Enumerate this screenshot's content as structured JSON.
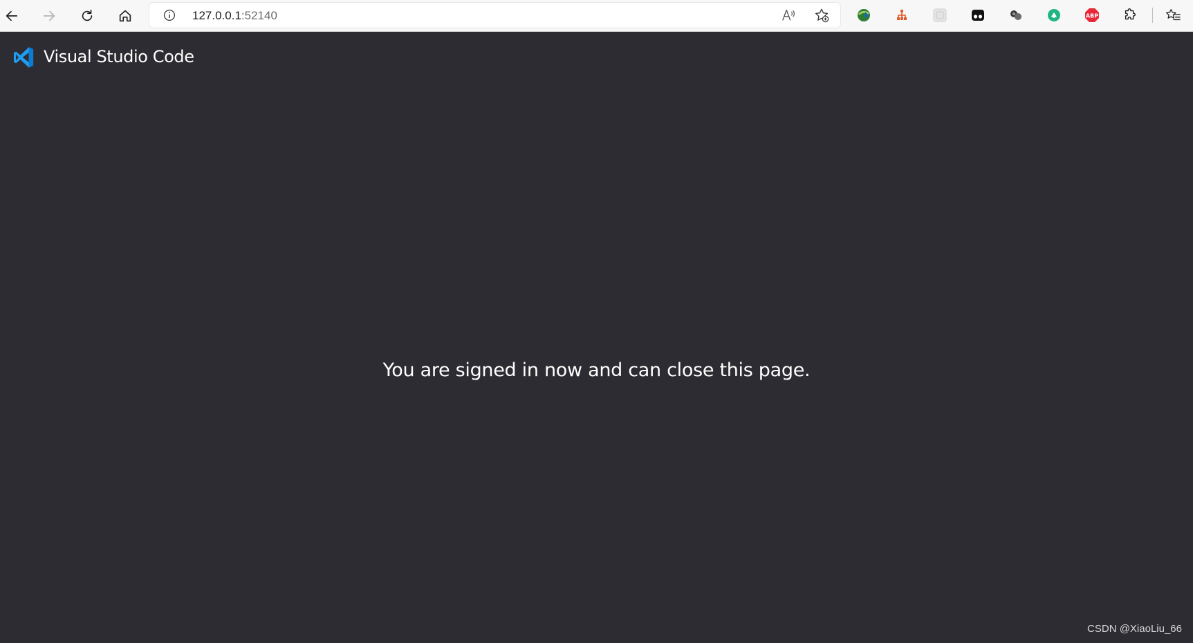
{
  "browser": {
    "address": {
      "host": "127.0.0.1",
      "port": ":52140"
    },
    "icons": {
      "back": "back-arrow-icon",
      "forward": "forward-arrow-icon",
      "refresh": "refresh-icon",
      "home": "home-icon",
      "info": "info-icon",
      "read_aloud": "read-aloud-icon",
      "add_favorite": "add-favorite-icon",
      "extensions": "extensions-icon",
      "favorites": "favorites-icon"
    },
    "extensions": [
      {
        "name": "idm-extension-icon",
        "color": "#2e7d32"
      },
      {
        "name": "extension-red-tree-icon",
        "color": "#e25a2b"
      },
      {
        "name": "extension-grey-icon",
        "color": "#cfcfcf"
      },
      {
        "name": "extension-black-icon",
        "color": "#111111"
      },
      {
        "name": "extension-dots-icon",
        "color": "#333333"
      },
      {
        "name": "extension-green-icon",
        "color": "#21b585"
      },
      {
        "name": "adblock-plus-icon",
        "color": "#e8283a",
        "text": "ABP"
      }
    ]
  },
  "page": {
    "brand": "Visual Studio Code",
    "message": "You are signed in now and can close this page.",
    "watermark": "CSDN @XiaoLiu_66",
    "background": "#2c2c32",
    "logo_color": "#1f9cf0"
  }
}
